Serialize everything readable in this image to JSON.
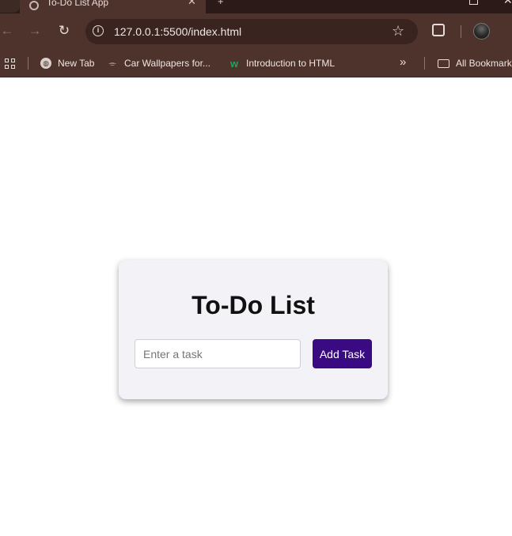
{
  "browser": {
    "tab": {
      "title": "To-Do List App",
      "close_glyph": "✕"
    },
    "url": "127.0.0.1:5500/index.html",
    "bookmarks": [
      {
        "label": "New Tab",
        "icon": "globe-icon"
      },
      {
        "label": "Car Wallpapers for...",
        "icon": "car-icon"
      },
      {
        "label": "Introduction to HTML",
        "icon": "w3schools-icon"
      }
    ],
    "all_bookmarks_label": "All Bookmarks",
    "colors": {
      "frame": "#4e322c",
      "tabstrip": "#2b1a17",
      "omnibox": "#3a241f"
    }
  },
  "page": {
    "title": "To-Do List",
    "task_input": {
      "placeholder": "Enter a task",
      "value": ""
    },
    "add_button_label": "Add Task",
    "colors": {
      "card_bg": "#f2f2f7",
      "button_bg": "#3a0a82"
    }
  }
}
